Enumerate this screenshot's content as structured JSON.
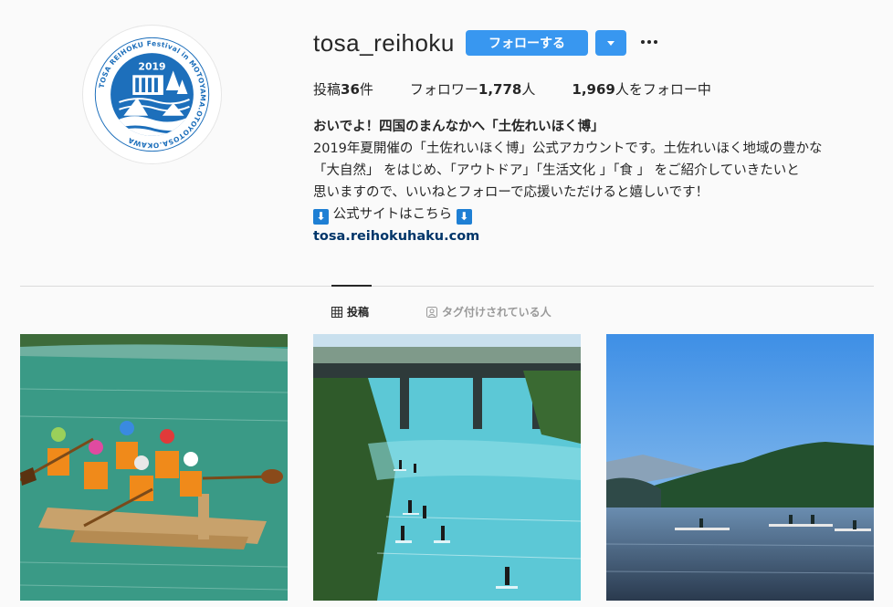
{
  "profile": {
    "username": "tosa_reihoku",
    "follow_label": "フォローする",
    "avatar_logo": {
      "year": "2019",
      "ring_text": "TOSA REIHOKU Festival in MOTOYAMA.OTOYOTOSA.OKAWA"
    }
  },
  "stats": {
    "posts_label": "投稿",
    "posts_count": "36",
    "posts_suffix": "件",
    "followers_label": "フォロワー",
    "followers_count": "1,778",
    "followers_suffix": "人",
    "following_count": "1,969",
    "following_label": "人をフォロー中"
  },
  "bio": {
    "name": "おいでよ！四国のまんなかへ「土佐れいほく博」",
    "line1": "2019年夏開催の「土佐れいほく博」公式アカウントです。土佐れいほく地域の豊かな",
    "line2": "「大自然」 をはじめ、「アウトドア」「生活文化 」「食 」 をご紹介していきたいと",
    "line3": "思いますので、いいねとフォローで応援いただけると嬉しいです！",
    "line4_text": " 公式サイトはこちら ",
    "arrow_glyph": "⬇",
    "link": "tosa.reihokuhaku.com"
  },
  "tabs": {
    "posts": "投稿",
    "tagged": "タグ付けされている人"
  },
  "colors": {
    "accent": "#3897f0",
    "logo_blue": "#1d6fbb",
    "link": "#003569"
  },
  "posts": [
    {
      "icon": "rafting-photo"
    },
    {
      "icon": "sup-river-bridge-photo"
    },
    {
      "icon": "lake-kayak-photo"
    }
  ]
}
